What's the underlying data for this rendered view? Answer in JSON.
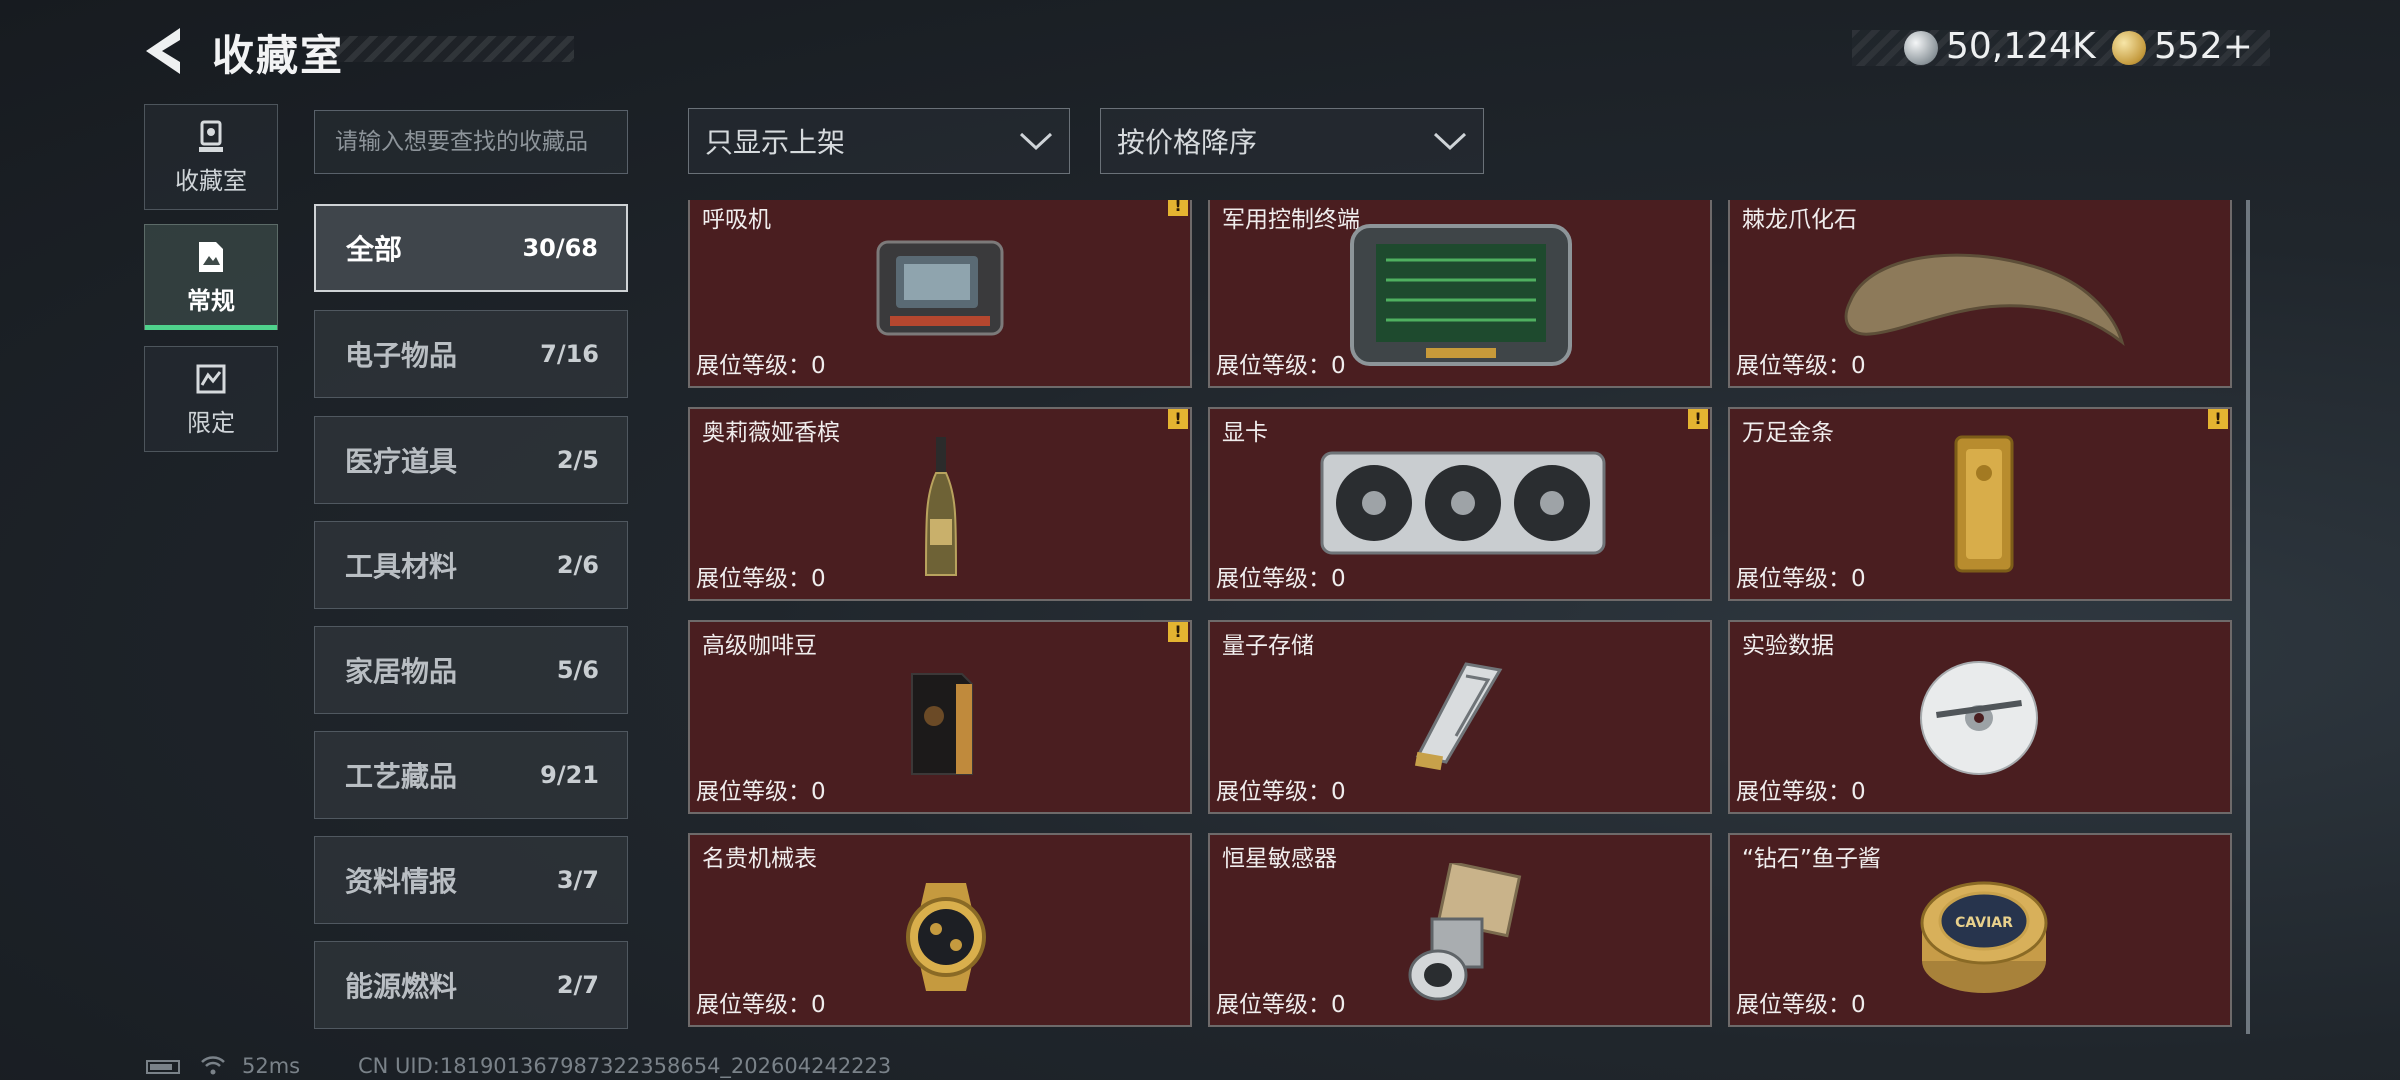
{
  "header": {
    "title": "收藏室",
    "currency_silver": "50,124K",
    "currency_gold": "552+"
  },
  "rail": [
    {
      "label": "收藏室",
      "icon": "trophy-icon"
    },
    {
      "label": "常规",
      "icon": "document-icon",
      "active": true
    },
    {
      "label": "限定",
      "icon": "limited-icon"
    }
  ],
  "search": {
    "placeholder": "请输入想要查找的收藏品"
  },
  "filters": {
    "shelf_filter": "只显示上架",
    "sort": "按价格降序"
  },
  "categories": [
    {
      "name": "全部",
      "count": "30/68",
      "active": true
    },
    {
      "name": "电子物品",
      "count": "7/16"
    },
    {
      "name": "医疗道具",
      "count": "2/5"
    },
    {
      "name": "工具材料",
      "count": "2/6"
    },
    {
      "name": "家居物品",
      "count": "5/6"
    },
    {
      "name": "工艺藏品",
      "count": "9/21"
    },
    {
      "name": "资料情报",
      "count": "3/7"
    },
    {
      "name": "能源燃料",
      "count": "2/7"
    }
  ],
  "items": [
    {
      "name": "呼吸机",
      "level": "展位等级：0",
      "alert": true,
      "icon": "respirator-icon"
    },
    {
      "name": "军用控制终端",
      "level": "展位等级：0",
      "alert": false,
      "icon": "control-terminal-icon"
    },
    {
      "name": "棘龙爪化石",
      "level": "展位等级：0",
      "alert": false,
      "icon": "claw-fossil-icon"
    },
    {
      "name": "奥莉薇娅香槟",
      "level": "展位等级：0",
      "alert": true,
      "icon": "champagne-icon"
    },
    {
      "name": "显卡",
      "level": "展位等级：0",
      "alert": true,
      "icon": "graphics-card-icon"
    },
    {
      "name": "万足金条",
      "level": "展位等级：0",
      "alert": true,
      "icon": "gold-bar-icon"
    },
    {
      "name": "高级咖啡豆",
      "level": "展位等级：0",
      "alert": true,
      "icon": "coffee-bag-icon"
    },
    {
      "name": "量子存储",
      "level": "展位等级：0",
      "alert": false,
      "icon": "quantum-storage-icon"
    },
    {
      "name": "实验数据",
      "level": "展位等级：0",
      "alert": false,
      "icon": "disc-icon"
    },
    {
      "name": "名贵机械表",
      "level": "展位等级：0",
      "alert": false,
      "icon": "watch-icon"
    },
    {
      "name": "恒星敏感器",
      "level": "展位等级：0",
      "alert": false,
      "icon": "star-sensor-icon"
    },
    {
      "name": "“钻石”鱼子酱",
      "level": "展位等级：0",
      "alert": false,
      "icon": "caviar-tin-icon"
    }
  ],
  "item_label_caviar": "CAVIAR",
  "alert_symbol": "!",
  "footer": {
    "ping": "52ms",
    "uid": "CN UID:181901367987322358654_202604242223"
  },
  "colors": {
    "card_bg": "#4a1e20",
    "active_accent": "#4fd28c",
    "alert": "#e4b431"
  }
}
